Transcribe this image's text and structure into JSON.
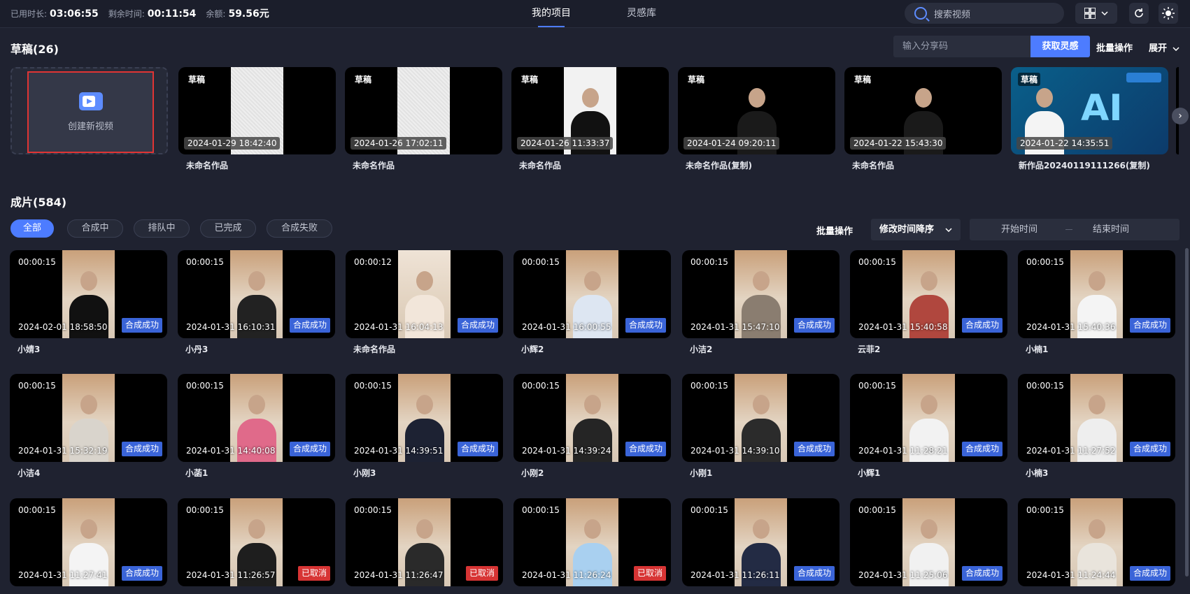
{
  "topbar": {
    "used_label": "已用时长:",
    "used_value": "03:06:55",
    "remain_label": "剩余时间:",
    "remain_value": "00:11:54",
    "balance_label": "余额:",
    "balance_value": "59.56元",
    "tabs": [
      {
        "label": "我的项目",
        "active": true
      },
      {
        "label": "灵感库",
        "active": false
      }
    ],
    "search_placeholder": "搜索视频",
    "icons": [
      "grid-view-icon",
      "chevron-down-icon",
      "refresh-icon",
      "theme-sun-icon"
    ]
  },
  "drafts": {
    "title": "草稿(26)",
    "share_placeholder": "输入分享码",
    "share_button": "获取灵感",
    "batch_label": "批量操作",
    "expand_label": "展开",
    "create_label": "创建新视频",
    "items": [
      {
        "tag": "草稿",
        "date": "2024-01-29 18:42:40",
        "name": "未命名作品",
        "thumb": "white"
      },
      {
        "tag": "草稿",
        "date": "2024-01-26 17:02:11",
        "name": "未命名作品",
        "thumb": "white"
      },
      {
        "tag": "草稿",
        "date": "2024-01-26 11:33:37",
        "name": "未命名作品",
        "thumb": "person-white"
      },
      {
        "tag": "草稿",
        "date": "2024-01-24 09:20:11",
        "name": "未命名作品(复制)",
        "thumb": "person-dark"
      },
      {
        "tag": "草稿",
        "date": "2024-01-22 15:43:30",
        "name": "未命名作品",
        "thumb": "person-dark"
      },
      {
        "tag": "草稿",
        "date": "2024-01-22 14:35:51",
        "name": "新作品20240119111266(复制)",
        "thumb": "ai"
      }
    ]
  },
  "finished": {
    "title": "成片(584)",
    "filters": [
      "全部",
      "合成中",
      "排队中",
      "已完成",
      "合成失败"
    ],
    "active_filter": "全部",
    "batch_label": "批量操作",
    "sort_label": "修改时间降序",
    "start_placeholder": "开始时间",
    "end_placeholder": "结束时间",
    "items": [
      {
        "duration": "00:00:15",
        "date": "2024-02-01 18:58:50",
        "status": "合成成功",
        "name": "小婧3"
      },
      {
        "duration": "00:00:15",
        "date": "2024-01-31 16:10:31",
        "status": "合成成功",
        "name": "小丹3"
      },
      {
        "duration": "00:00:12",
        "date": "2024-01-31 16:04:13",
        "status": "合成成功",
        "name": "未命名作品"
      },
      {
        "duration": "00:00:15",
        "date": "2024-01-31 16:00:55",
        "status": "合成成功",
        "name": "小辉2"
      },
      {
        "duration": "00:00:15",
        "date": "2024-01-31 15:47:10",
        "status": "合成成功",
        "name": "小洁2"
      },
      {
        "duration": "00:00:15",
        "date": "2024-01-31 15:40:58",
        "status": "合成成功",
        "name": "云菲2"
      },
      {
        "duration": "00:00:15",
        "date": "2024-01-31 15:40:36",
        "status": "合成成功",
        "name": "小楠1"
      },
      {
        "duration": "00:00:15",
        "date": "2024-01-31 15:32:19",
        "status": "合成成功",
        "name": "小洁4"
      },
      {
        "duration": "00:00:15",
        "date": "2024-01-31 14:40:08",
        "status": "合成成功",
        "name": "小菡1"
      },
      {
        "duration": "00:00:15",
        "date": "2024-01-31 14:39:51",
        "status": "合成成功",
        "name": "小刚3"
      },
      {
        "duration": "00:00:15",
        "date": "2024-01-31 14:39:24",
        "status": "合成成功",
        "name": "小刚2"
      },
      {
        "duration": "00:00:15",
        "date": "2024-01-31 14:39:10",
        "status": "合成成功",
        "name": "小刚1"
      },
      {
        "duration": "00:00:15",
        "date": "2024-01-31 11:28:21",
        "status": "合成成功",
        "name": "小辉1"
      },
      {
        "duration": "00:00:15",
        "date": "2024-01-31 11:27:52",
        "status": "合成成功",
        "name": "小楠3"
      },
      {
        "duration": "00:00:15",
        "date": "2024-01-31 11:27:41",
        "status": "合成成功",
        "name": ""
      },
      {
        "duration": "00:00:15",
        "date": "2024-01-31 11:26:57",
        "status": "已取消",
        "name": ""
      },
      {
        "duration": "00:00:15",
        "date": "2024-01-31 11:26:47",
        "status": "已取消",
        "name": ""
      },
      {
        "duration": "00:00:15",
        "date": "2024-01-31 11:26:24",
        "status": "已取消",
        "name": ""
      },
      {
        "duration": "00:00:15",
        "date": "2024-01-31 11:26:11",
        "status": "合成成功",
        "name": ""
      },
      {
        "duration": "00:00:15",
        "date": "2024-01-31 11:25:06",
        "status": "合成成功",
        "name": ""
      },
      {
        "duration": "00:00:15",
        "date": "2024-01-31 11:24:44",
        "status": "合成成功",
        "name": ""
      }
    ]
  },
  "colors": {
    "accent": "#4d7cff",
    "success_badge": "#3a64d8",
    "cancel_badge": "#d73434",
    "highlight_border": "#e03434"
  }
}
